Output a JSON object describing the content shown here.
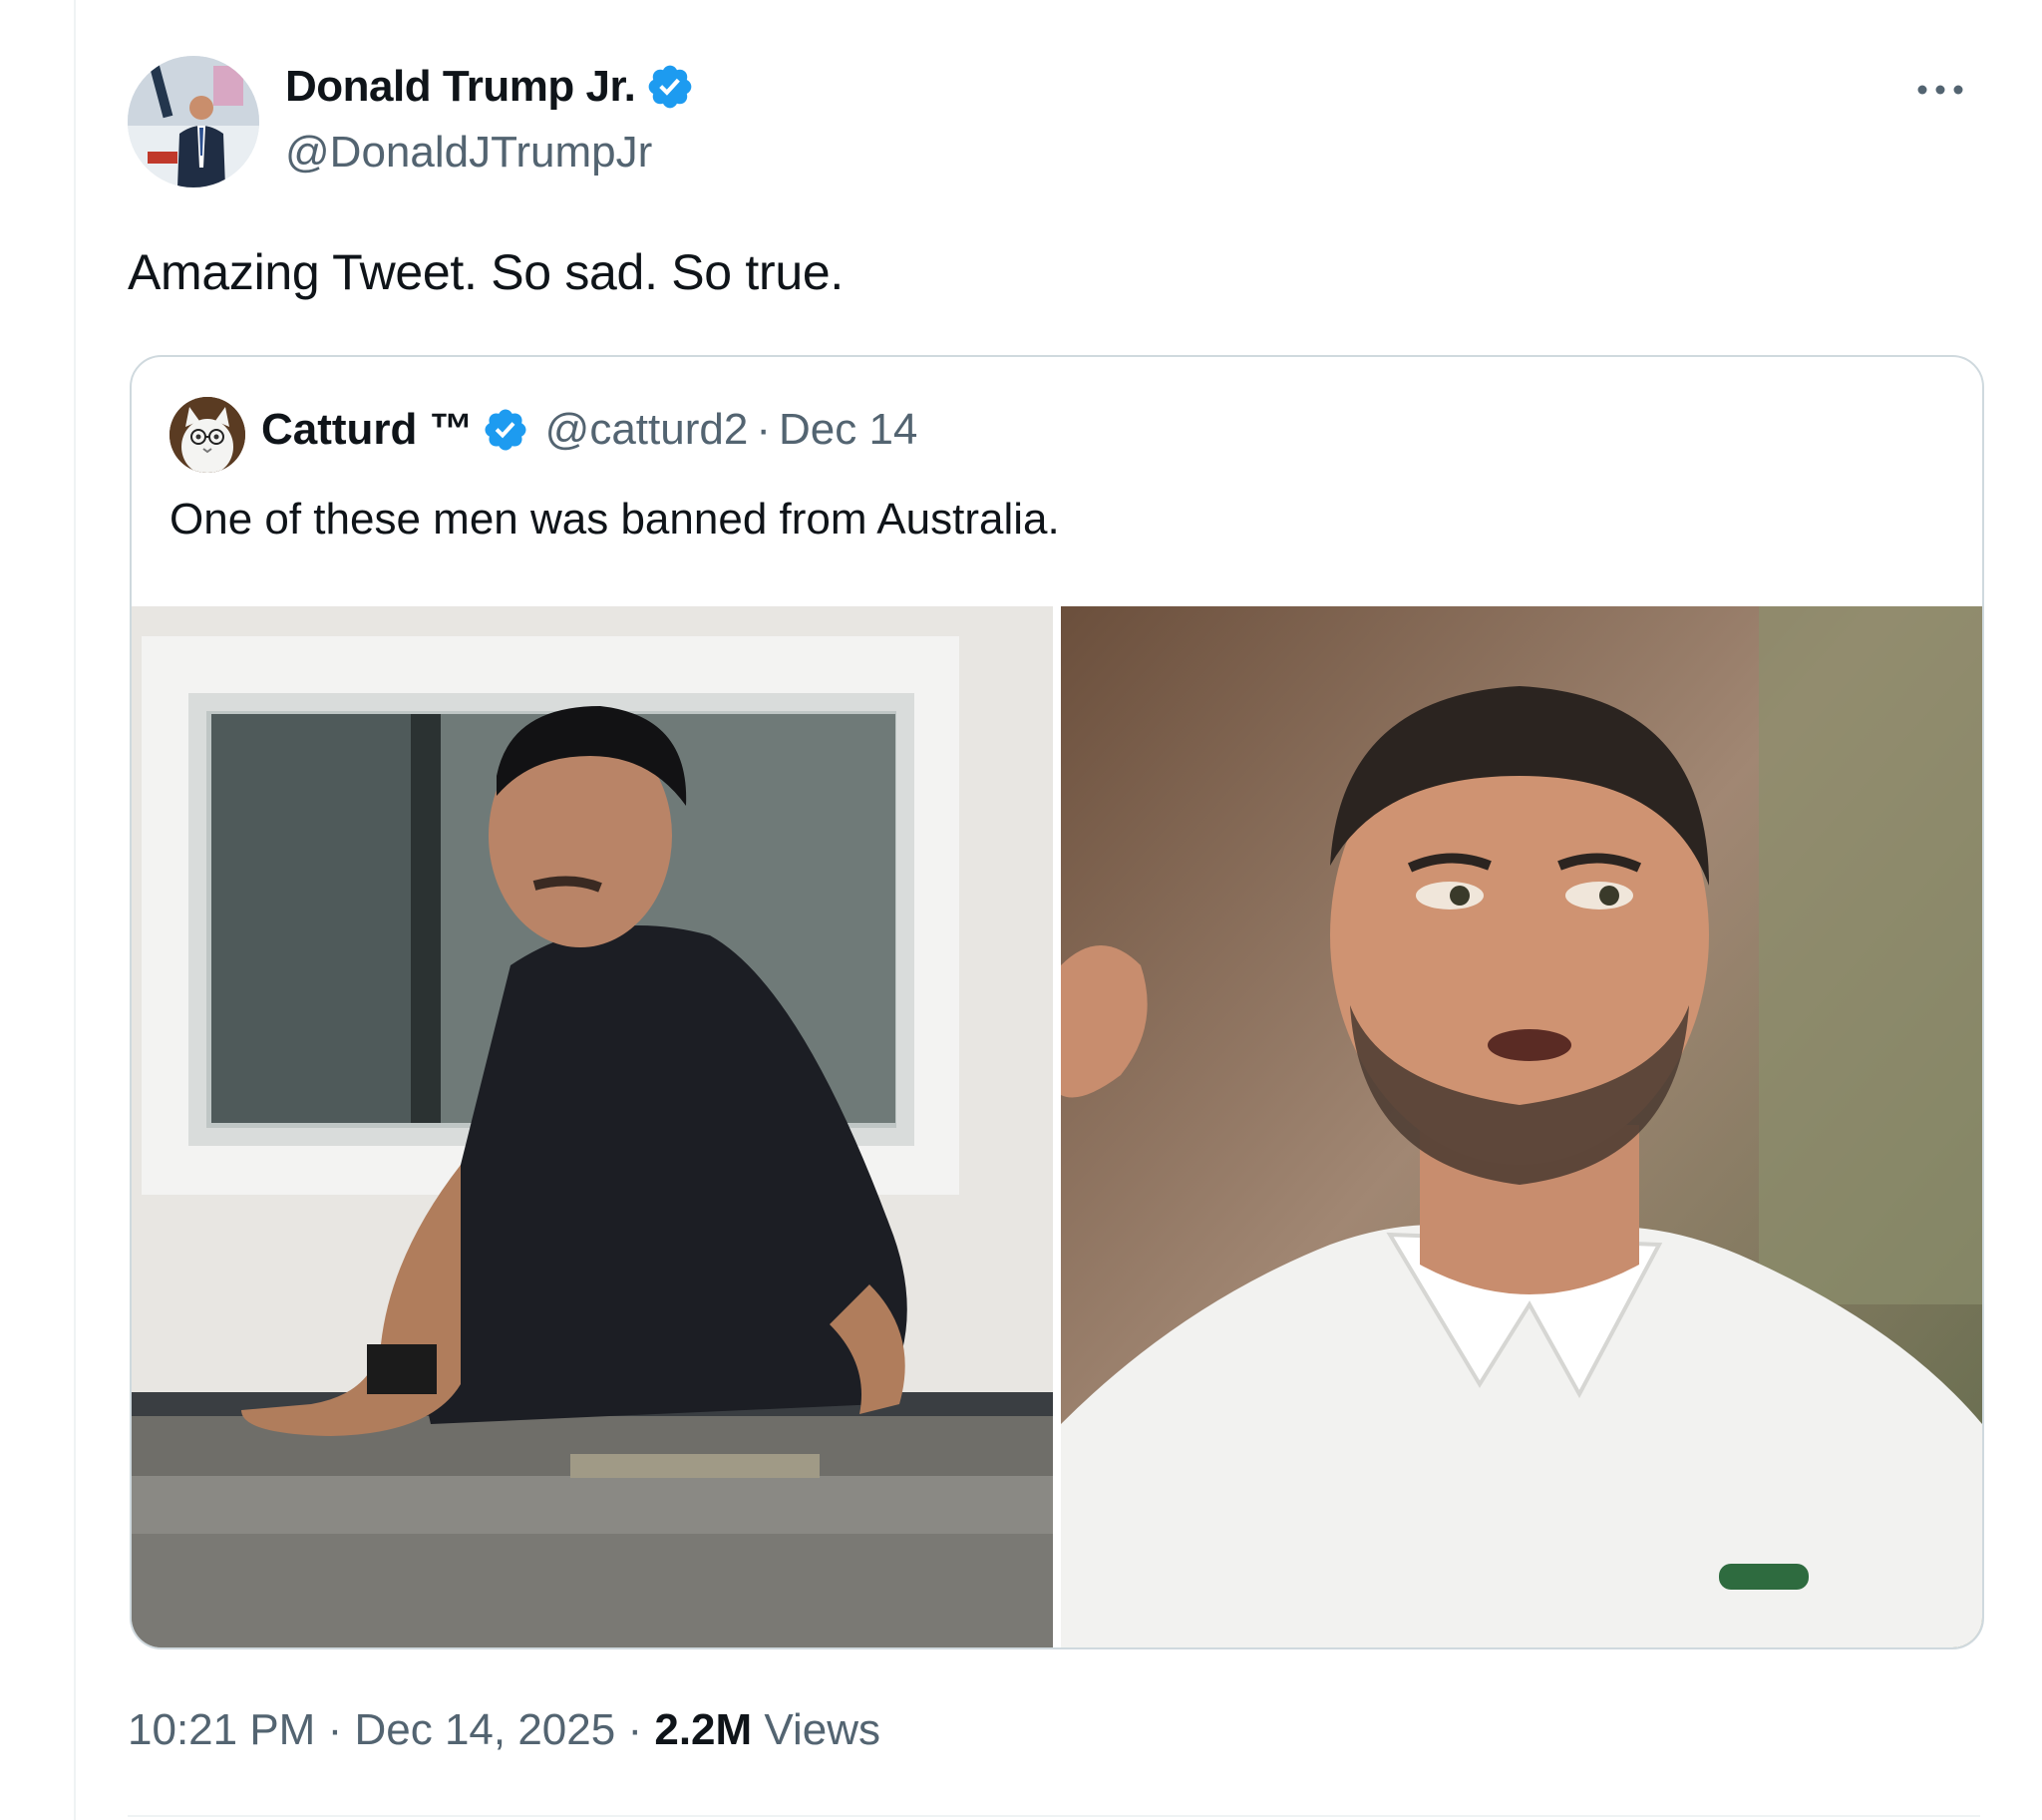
{
  "tweet": {
    "author": {
      "display_name": "Donald Trump Jr.",
      "handle": "@DonaldJTrumpJr",
      "verified": true,
      "avatar_icon": "profile-photo"
    },
    "text": "Amazing Tweet. So sad. So true.",
    "more_icon": "more-dots-icon",
    "quote": {
      "author": {
        "display_name": "Catturd ™",
        "handle": "@catturd2",
        "verified": true,
        "avatar_icon": "cat-profile-photo"
      },
      "separator": "·",
      "date": "Dec 14",
      "text": "One of these men was banned from Australia.",
      "media": [
        {
          "name": "photo-man-on-rooftop"
        },
        {
          "name": "photo-tennis-player"
        }
      ]
    },
    "meta": {
      "time": "10:21 PM",
      "separator": "·",
      "date": "Dec 14, 2025",
      "separator2": "·",
      "views_count": "2.2M",
      "views_label": "Views"
    },
    "colors": {
      "verified": "#1d9bf0",
      "secondary_text": "#536471",
      "border": "#cfd9de"
    }
  }
}
